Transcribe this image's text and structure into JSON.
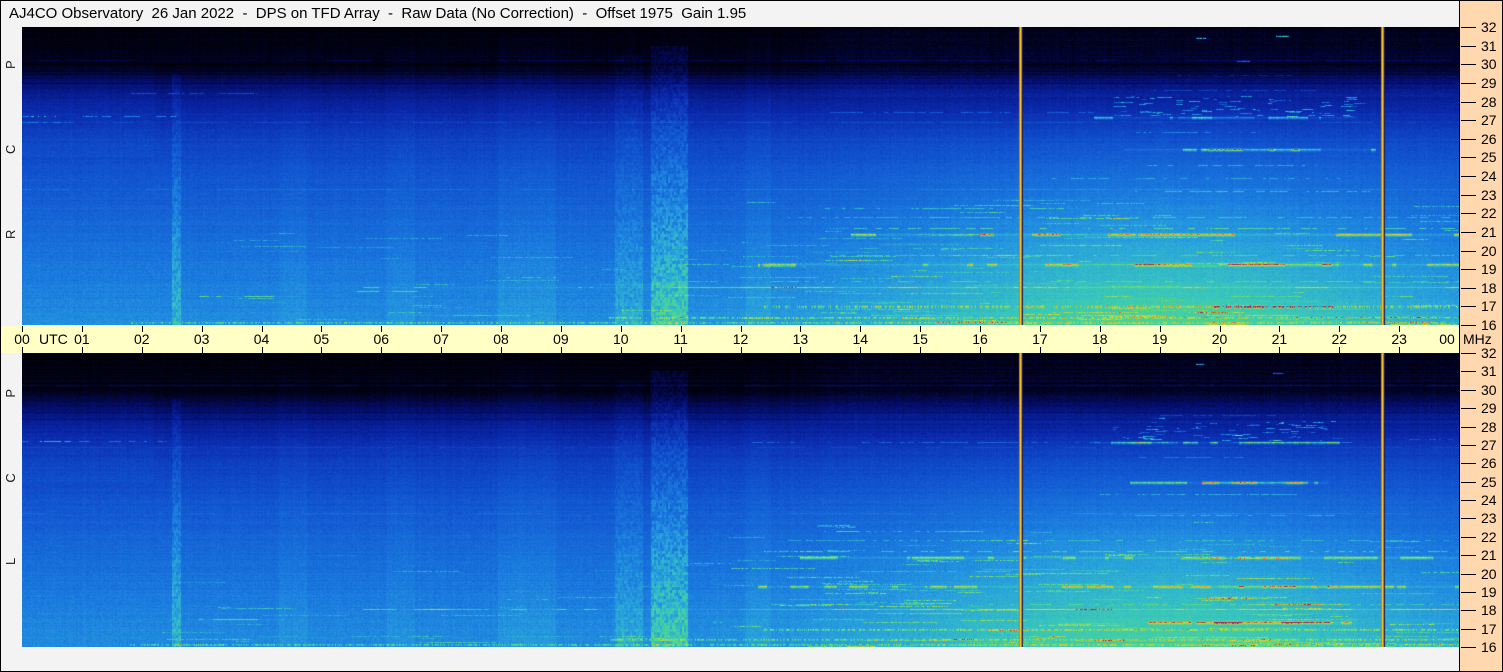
{
  "header": {
    "title": "AJ4CO Observatory  26 Jan 2022  -  DPS on TFD Array  -  Raw Data (No Correction)  -  Offset 1975  Gain 1.95"
  },
  "colors": {
    "titlebar_bg": "#f3f3f3",
    "margin_bg": "#f3f3f3",
    "time_axis_bg": "#ffffc6",
    "freq_axis_bg": "#ffd8b0",
    "axis_text": "#000000",
    "border": "#000000",
    "marker_edge": "#d47618",
    "marker_core": "#ffd62c"
  },
  "chart_data": {
    "type": "heatmap",
    "subtype": "radio-spectrogram-dynamic-spectrum",
    "title": "AJ4CO Observatory  26 Jan 2022  -  DPS on TFD Array  -  Raw Data (No Correction)  -  Offset 1975  Gain 1.95",
    "x_axis": {
      "unit_label": "UTC",
      "range_hours": [
        0,
        24
      ],
      "tick_labels": [
        "00",
        "01",
        "02",
        "03",
        "04",
        "05",
        "06",
        "07",
        "08",
        "09",
        "10",
        "11",
        "12",
        "13",
        "14",
        "15",
        "16",
        "17",
        "18",
        "19",
        "20",
        "21",
        "22",
        "23",
        "00"
      ]
    },
    "y_axis": {
      "unit_label": "MHz",
      "range_mhz": [
        16,
        32
      ],
      "tick_labels": [
        32,
        31,
        30,
        29,
        28,
        27,
        26,
        25,
        24,
        23,
        22,
        21,
        20,
        19,
        18,
        17,
        16
      ]
    },
    "marker_lines_utc": [
      16.67,
      22.71
    ],
    "palette": [
      [
        0.0,
        0,
        0,
        0
      ],
      [
        0.05,
        2,
        2,
        30
      ],
      [
        0.13,
        4,
        14,
        110
      ],
      [
        0.22,
        10,
        40,
        170
      ],
      [
        0.32,
        16,
        80,
        205
      ],
      [
        0.42,
        26,
        120,
        222
      ],
      [
        0.5,
        40,
        160,
        222
      ],
      [
        0.58,
        56,
        198,
        190
      ],
      [
        0.66,
        80,
        216,
        140
      ],
      [
        0.74,
        150,
        225,
        70
      ],
      [
        0.81,
        220,
        220,
        40
      ],
      [
        0.87,
        245,
        170,
        25
      ],
      [
        0.92,
        238,
        90,
        20
      ],
      [
        0.97,
        205,
        25,
        25
      ],
      [
        1.0,
        185,
        10,
        95
      ]
    ],
    "background_profile": [
      [
        32,
        0.02
      ],
      [
        31,
        0.035
      ],
      [
        30.4,
        0.05
      ],
      [
        29.9,
        0.035
      ],
      [
        29.3,
        0.1
      ],
      [
        28.5,
        0.16
      ],
      [
        27.5,
        0.22
      ],
      [
        26,
        0.28
      ],
      [
        24,
        0.33
      ],
      [
        22,
        0.37
      ],
      [
        20,
        0.405
      ],
      [
        18,
        0.435
      ],
      [
        17,
        0.45
      ],
      [
        16,
        0.465
      ]
    ],
    "day_brightening": {
      "amp": 0.17,
      "center_utc": 19.0,
      "sigma_hours": 4.8,
      "f_hi": 29,
      "f_span": 13
    },
    "texture": {
      "afternoon_dashes": 140,
      "morning_dashes": 30
    },
    "panels": [
      {
        "id": "RCP",
        "polarization_label": "R C P",
        "seed": 1337,
        "events": [
          {
            "t": [
              2.5,
              2.64
            ],
            "boost": 0.11,
            "fmax": 29.5,
            "striped": true
          },
          {
            "t": [
              9.9,
              10.35
            ],
            "boost": 0.07,
            "fmax": 30.5,
            "striped": true
          },
          {
            "t": [
              10.5,
              11.1
            ],
            "boost": 0.15,
            "fmax": 31,
            "striped": true
          },
          {
            "t": [
              4.3,
              4.75
            ],
            "boost": 0.022,
            "fmax": 31,
            "striped": false
          },
          {
            "t": [
              6.1,
              6.55
            ],
            "boost": 0.022,
            "fmax": 31,
            "striped": false
          },
          {
            "t": [
              7.95,
              8.9
            ],
            "boost": 0.03,
            "fmax": 31.5,
            "striped": false
          },
          {
            "t": [
              12.1,
              12.5
            ],
            "boost": 0.025,
            "fmax": 31.5,
            "striped": false
          }
        ],
        "lines": [
          {
            "f": 30.25,
            "t": [
              0,
              24
            ],
            "boost": 0.05,
            "style": "solid",
            "h": 1
          },
          {
            "f": 26.9,
            "t": [
              0,
              24
            ],
            "boost": 0.055,
            "style": "solid",
            "h": 1
          },
          {
            "f": 23.3,
            "t": [
              0,
              24
            ],
            "boost": 0.05,
            "style": "solid",
            "h": 1
          },
          {
            "f": 27.2,
            "t": [
              0,
              2.6
            ],
            "boost": 0.2,
            "style": "dash",
            "h": 1,
            "hot": [
              0.15,
              0.95,
              0.12
            ]
          },
          {
            "f": 28.45,
            "t": [
              1.8,
              3.9
            ],
            "boost": 0.13,
            "style": "dash",
            "h": 1
          },
          {
            "f": 17.55,
            "t": [
              2.95,
              4.6
            ],
            "boost": 0.22,
            "style": "solid",
            "h": 1
          },
          {
            "f": 17.8,
            "t": [
              5.6,
              6.6
            ],
            "boost": 0.18,
            "style": "solid",
            "h": 1
          },
          {
            "f": 18.05,
            "t": [
              5.7,
              24
            ],
            "boost": 0.2,
            "style": "solid",
            "h": 1,
            "hot": [
              12,
              24,
              0.07
            ]
          },
          {
            "f": 18.6,
            "t": [
              8.1,
              8.9
            ],
            "boost": 0.12,
            "style": "dash",
            "h": 1
          },
          {
            "f": 16.15,
            "t": [
              1.8,
              24
            ],
            "boost": 0.2,
            "style": "speckle",
            "h": 2
          },
          {
            "f": 16.45,
            "t": [
              9.8,
              24
            ],
            "boost": 0.24,
            "style": "speckle",
            "h": 2
          },
          {
            "f": 17.0,
            "t": [
              12.4,
              24
            ],
            "boost": 0.26,
            "style": "speckle",
            "h": 2,
            "hot": [
              19.9,
              21.9,
              0.4
            ]
          },
          {
            "f": 18.35,
            "t": [
              12.5,
              24
            ],
            "boost": 0.12,
            "style": "dash",
            "h": 1
          },
          {
            "f": 19.3,
            "t": [
              12.3,
              24
            ],
            "boost": 0.3,
            "style": "solid",
            "h": 2,
            "hot": [
              20,
              22,
              0.14
            ]
          },
          {
            "f": 19.75,
            "t": [
              13.5,
              24
            ],
            "boost": 0.12,
            "style": "dash",
            "h": 1
          },
          {
            "f": 20.15,
            "t": [
              14,
              16.5
            ],
            "boost": 0.1,
            "style": "dash",
            "h": 1
          },
          {
            "f": 20.9,
            "t": [
              13.85,
              24
            ],
            "boost": 0.34,
            "style": "solid",
            "h": 2
          },
          {
            "f": 21.2,
            "t": [
              13.9,
              24
            ],
            "boost": 0.18,
            "style": "dash",
            "h": 1
          },
          {
            "f": 21.8,
            "t": [
              12.8,
              24
            ],
            "boost": 0.12,
            "style": "dash",
            "h": 1
          },
          {
            "f": 22.3,
            "t": [
              13.4,
              16.2
            ],
            "boost": 0.14,
            "style": "dash",
            "h": 1
          },
          {
            "f": 23.2,
            "t": [
              18.4,
              22.5
            ],
            "boost": 0.15,
            "style": "dash",
            "h": 1
          },
          {
            "f": 23.9,
            "t": [
              17.2,
              22
            ],
            "boost": 0.12,
            "style": "dash",
            "h": 1
          },
          {
            "f": 24.6,
            "t": [
              18.8,
              21.6
            ],
            "boost": 0.14,
            "style": "dash",
            "h": 1
          },
          {
            "f": 25.45,
            "t": [
              18.4,
              22.6
            ],
            "boost": 0.36,
            "style": "solid",
            "h": 2,
            "hot": [
              19.8,
              21.7,
              0.2
            ]
          },
          {
            "f": 26.35,
            "t": [
              18.6,
              20.6
            ],
            "boost": 0.15,
            "style": "dash",
            "h": 1
          },
          {
            "f": 27.45,
            "t": [
              13.5,
              17.9
            ],
            "boost": 0.12,
            "style": "dash",
            "h": 1
          },
          {
            "f": 27.15,
            "t": [
              17.9,
              22.3
            ],
            "boost": 0.32,
            "style": "solid",
            "h": 2,
            "hot": [
              19.3,
              20.6,
              0.12
            ]
          },
          {
            "f": 27.75,
            "t": [
              18.2,
              22.3
            ],
            "boost": 0.2,
            "style": "blob",
            "h": 8
          },
          {
            "f": 28.6,
            "t": [
              18.9,
              21.6
            ],
            "boost": 0.1,
            "style": "dash",
            "h": 1
          },
          {
            "f": 29.4,
            "t": [
              19.3,
              21.2
            ],
            "boost": 0.08,
            "style": "dash",
            "h": 1
          },
          {
            "f": 31.4,
            "t": [
              19.6,
              19.8
            ],
            "boost": 0.5,
            "style": "solid",
            "h": 1
          },
          {
            "f": 31.5,
            "t": [
              20.95,
              21.15
            ],
            "boost": 0.5,
            "style": "solid",
            "h": 1
          },
          {
            "f": 30.2,
            "t": [
              20.3,
              20.5
            ],
            "boost": 0.3,
            "style": "solid",
            "h": 1
          },
          {
            "f": 26.9,
            "t": [
              0,
              0.8
            ],
            "boost": 0.12,
            "style": "dash",
            "h": 1
          }
        ]
      },
      {
        "id": "LCP",
        "polarization_label": "L C P",
        "seed": 9001,
        "events": [
          {
            "t": [
              2.5,
              2.64
            ],
            "boost": 0.11,
            "fmax": 29.5,
            "striped": true
          },
          {
            "t": [
              9.9,
              10.35
            ],
            "boost": 0.07,
            "fmax": 30.5,
            "striped": true
          },
          {
            "t": [
              10.5,
              11.1
            ],
            "boost": 0.15,
            "fmax": 31,
            "striped": true
          },
          {
            "t": [
              4.3,
              4.75
            ],
            "boost": 0.02,
            "fmax": 31,
            "striped": false
          },
          {
            "t": [
              6.1,
              6.55
            ],
            "boost": 0.02,
            "fmax": 31,
            "striped": false
          },
          {
            "t": [
              7.95,
              8.9
            ],
            "boost": 0.03,
            "fmax": 31.5,
            "striped": false
          },
          {
            "t": [
              12.1,
              12.5
            ],
            "boost": 0.025,
            "fmax": 31.5,
            "striped": false
          }
        ],
        "lines": [
          {
            "f": 30.25,
            "t": [
              0,
              24
            ],
            "boost": 0.05,
            "style": "solid",
            "h": 1
          },
          {
            "f": 26.9,
            "t": [
              0,
              24
            ],
            "boost": 0.05,
            "style": "solid",
            "h": 1
          },
          {
            "f": 23.3,
            "t": [
              0,
              24
            ],
            "boost": 0.045,
            "style": "solid",
            "h": 1
          },
          {
            "f": 27.2,
            "t": [
              0,
              2.4
            ],
            "boost": 0.16,
            "style": "dash",
            "h": 1,
            "hot": [
              0.2,
              0.9,
              0.1
            ]
          },
          {
            "f": 17.55,
            "t": [
              2.95,
              4.4
            ],
            "boost": 0.2,
            "style": "solid",
            "h": 1
          },
          {
            "f": 18.05,
            "t": [
              5.7,
              24
            ],
            "boost": 0.18,
            "style": "solid",
            "h": 1,
            "hot": [
              12,
              24,
              0.06
            ]
          },
          {
            "f": 18.6,
            "t": [
              8.1,
              8.9
            ],
            "boost": 0.1,
            "style": "dash",
            "h": 1
          },
          {
            "f": 16.15,
            "t": [
              1.8,
              24
            ],
            "boost": 0.2,
            "style": "speckle",
            "h": 2
          },
          {
            "f": 16.45,
            "t": [
              9.8,
              24
            ],
            "boost": 0.24,
            "style": "speckle",
            "h": 2
          },
          {
            "f": 17.0,
            "t": [
              12.4,
              24
            ],
            "boost": 0.24,
            "style": "speckle",
            "h": 2
          },
          {
            "f": 17.35,
            "t": [
              18.8,
              22.2
            ],
            "boost": 0.3,
            "style": "solid",
            "h": 2,
            "hot": [
              19.9,
              21.9,
              0.26
            ]
          },
          {
            "f": 18.35,
            "t": [
              12.5,
              24
            ],
            "boost": 0.11,
            "style": "dash",
            "h": 1
          },
          {
            "f": 19.3,
            "t": [
              12.3,
              24
            ],
            "boost": 0.28,
            "style": "solid",
            "h": 2,
            "hot": [
              20,
              22,
              0.12
            ]
          },
          {
            "f": 20.15,
            "t": [
              14,
              16.5
            ],
            "boost": 0.1,
            "style": "dash",
            "h": 1
          },
          {
            "f": 20.9,
            "t": [
              13.0,
              24
            ],
            "boost": 0.33,
            "style": "solid",
            "h": 2
          },
          {
            "f": 21.2,
            "t": [
              13.0,
              24
            ],
            "boost": 0.17,
            "style": "dash",
            "h": 1
          },
          {
            "f": 21.8,
            "t": [
              12.8,
              24
            ],
            "boost": 0.11,
            "style": "dash",
            "h": 1
          },
          {
            "f": 22.3,
            "t": [
              13.4,
              16
            ],
            "boost": 0.12,
            "style": "dash",
            "h": 1
          },
          {
            "f": 23.2,
            "t": [
              18.4,
              22
            ],
            "boost": 0.12,
            "style": "dash",
            "h": 1
          },
          {
            "f": 24.35,
            "t": [
              18,
              21.5
            ],
            "boost": 0.14,
            "style": "dash",
            "h": 1
          },
          {
            "f": 25.0,
            "t": [
              18.5,
              21.8
            ],
            "boost": 0.3,
            "style": "solid",
            "h": 2,
            "hot": [
              19.7,
              21.4,
              0.18
            ]
          },
          {
            "f": 26.35,
            "t": [
              18.6,
              20.4
            ],
            "boost": 0.12,
            "style": "dash",
            "h": 1
          },
          {
            "f": 27.15,
            "t": [
              12.2,
              22.2
            ],
            "boost": 0.12,
            "style": "dash",
            "h": 1
          },
          {
            "f": 27.15,
            "t": [
              17.9,
              22.0
            ],
            "boost": 0.3,
            "style": "solid",
            "h": 2,
            "hot": [
              18.5,
              19.3,
              0.12
            ]
          },
          {
            "f": 27.75,
            "t": [
              18.2,
              22.0
            ],
            "boost": 0.18,
            "style": "blob",
            "h": 8
          },
          {
            "f": 28.6,
            "t": [
              19.0,
              21.4
            ],
            "boost": 0.1,
            "style": "dash",
            "h": 1
          },
          {
            "f": 28.45,
            "t": [
              18.8,
              19.1
            ],
            "boost": 0.28,
            "style": "solid",
            "h": 1
          },
          {
            "f": 31.4,
            "t": [
              19.6,
              19.75
            ],
            "boost": 0.45,
            "style": "solid",
            "h": 1
          },
          {
            "f": 30.9,
            "t": [
              20.9,
              21.1
            ],
            "boost": 0.3,
            "style": "solid",
            "h": 1
          },
          {
            "f": 27.3,
            "t": [
              22.8,
              24
            ],
            "boost": 0.1,
            "style": "dash",
            "h": 1
          }
        ]
      }
    ]
  }
}
